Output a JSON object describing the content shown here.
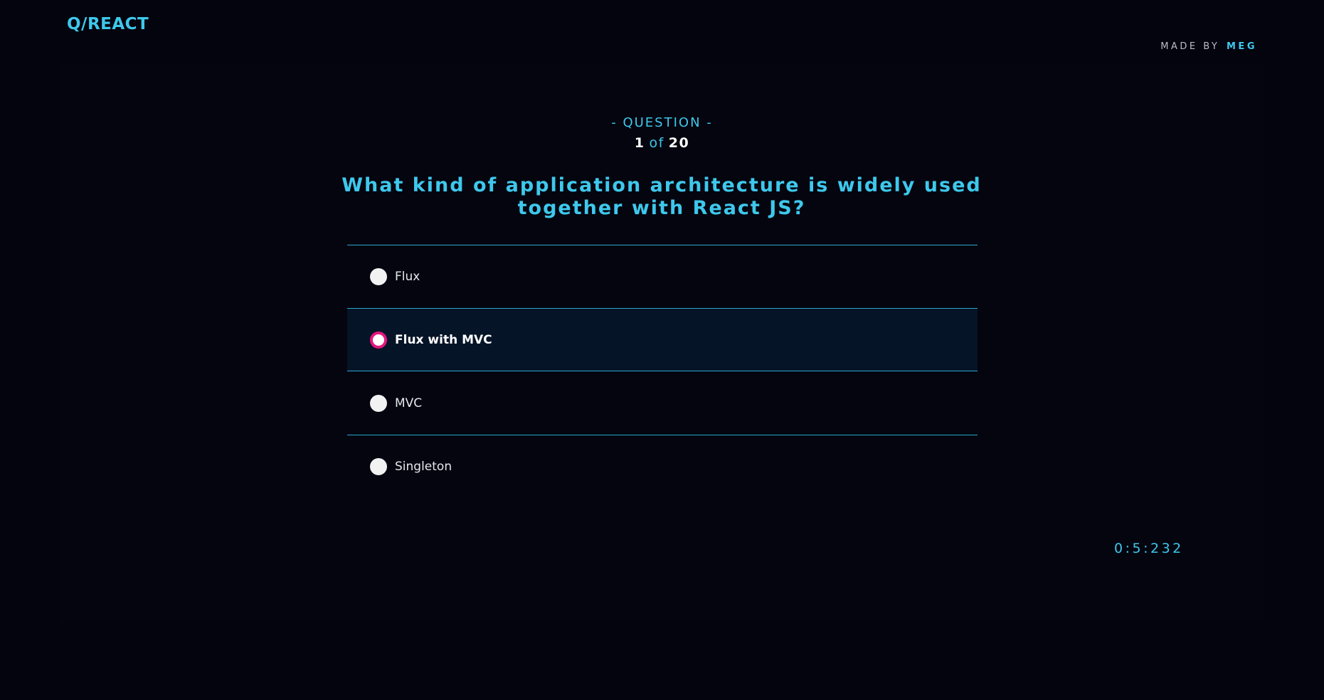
{
  "app": {
    "logo_text": "Q/REACT",
    "credit_prefix": "MADE BY",
    "credit_author": "MEG"
  },
  "quiz": {
    "section_label": "- QUESTION -",
    "current": "1",
    "of_label": "of",
    "total": "20",
    "question": "What kind of application architecture is widely used together with React JS?",
    "answers": [
      {
        "label": "Flux",
        "selected": false
      },
      {
        "label": "Flux with MVC",
        "selected": true
      },
      {
        "label": "MVC",
        "selected": false
      },
      {
        "label": "Singleton",
        "selected": false
      }
    ],
    "timer": "0:5:232"
  },
  "colors": {
    "background": "#03040e",
    "accent": "#3ec8ec",
    "selected_radio": "#e4177f",
    "selected_row": "#061427"
  }
}
